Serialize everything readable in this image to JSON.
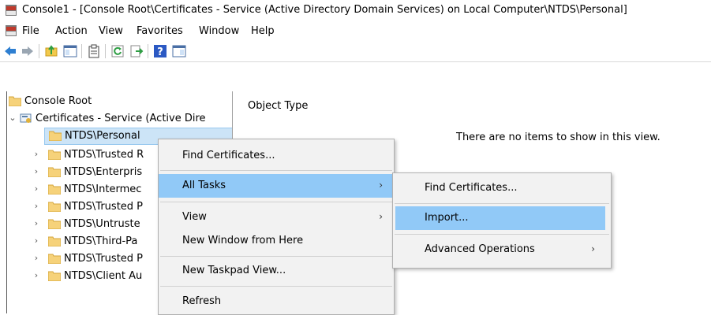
{
  "window": {
    "title": "Console1 - [Console Root\\Certificates - Service (Active Directory Domain Services) on Local Computer\\NTDS\\Personal]"
  },
  "menubar": {
    "items": [
      "File",
      "Action",
      "View",
      "Favorites",
      "Window",
      "Help"
    ]
  },
  "toolbar": {
    "buttons": [
      "back-icon",
      "forward-icon",
      "up-folder-icon",
      "show-hide-tree-icon",
      "clipboard-icon",
      "refresh-icon",
      "export-list-icon",
      "help-icon",
      "action-pane-icon"
    ]
  },
  "tree": {
    "root": "Console Root",
    "snapin": "Certificates - Service (Active Dire",
    "items": [
      "NTDS\\Personal",
      "NTDS\\Trusted R",
      "NTDS\\Enterpris",
      "NTDS\\Intermec",
      "NTDS\\Trusted P",
      "NTDS\\Untruste",
      "NTDS\\Third-Pa",
      "NTDS\\Trusted P",
      "NTDS\\Client Au"
    ]
  },
  "listview": {
    "column_header": "Object Type",
    "empty_message": "There are no items to show in this view."
  },
  "context_menu": {
    "items": [
      "Find Certificates...",
      "All Tasks",
      "View",
      "New Window from Here",
      "New Taskpad View...",
      "Refresh"
    ]
  },
  "submenu": {
    "items": [
      "Find Certificates...",
      "Import...",
      "Advanced Operations"
    ]
  },
  "colors": {
    "highlight": "#91c9f7",
    "menu_bg": "#f2f2f2",
    "selection": "#cce4f7"
  }
}
